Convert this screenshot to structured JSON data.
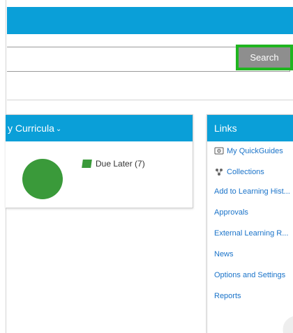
{
  "search": {
    "button_label": "Search",
    "placeholder": "",
    "value": ""
  },
  "curricula_panel": {
    "title": "y Curricula",
    "legend_label": "Due Later (7)",
    "pie_color": "#3a9a3a"
  },
  "links_panel": {
    "title": "Links",
    "items": [
      {
        "label": "My QuickGuides",
        "icon": "quickguide-icon"
      },
      {
        "label": "Collections",
        "icon": "collections-icon"
      },
      {
        "label": "Add to Learning Hist..."
      },
      {
        "label": "Approvals"
      },
      {
        "label": "External Learning R..."
      },
      {
        "label": "News"
      },
      {
        "label": "Options and Settings"
      },
      {
        "label": "Reports"
      }
    ]
  },
  "colors": {
    "brand_blue": "#0a9fd8",
    "link_blue": "#1a73c9",
    "focus_green": "#1fb51f",
    "button_gray": "#8e8e8e"
  }
}
